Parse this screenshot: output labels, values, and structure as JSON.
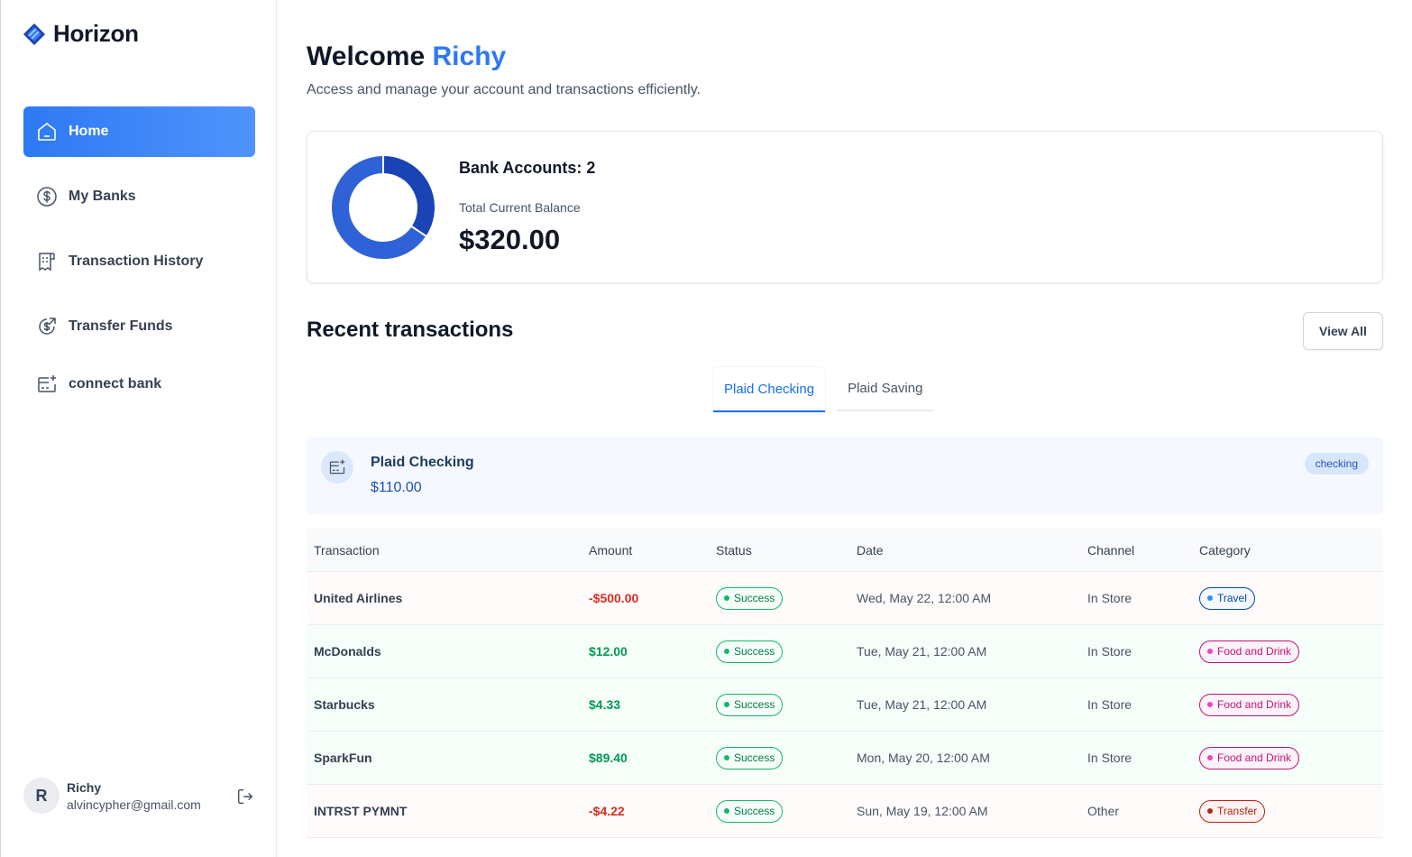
{
  "brand": {
    "name": "Horizon",
    "logo_icon": "horizon-logo-icon",
    "accent": "#2e79f4"
  },
  "sidebar": {
    "items": [
      {
        "label": "Home",
        "icon": "home-icon",
        "active": true
      },
      {
        "label": "My Banks",
        "icon": "dollar-circle-icon",
        "active": false
      },
      {
        "label": "Transaction History",
        "icon": "receipt-icon",
        "active": false
      },
      {
        "label": "Transfer Funds",
        "icon": "money-send-icon",
        "active": false
      },
      {
        "label": "connect bank",
        "icon": "card-add-icon",
        "active": false
      }
    ],
    "user": {
      "initial": "R",
      "name": "Richy",
      "email": "alvincypher@gmail.com",
      "logout_icon": "logout-icon"
    }
  },
  "header": {
    "welcome": "Welcome",
    "user_name": "Richy",
    "subtitle": "Access and manage your account and transactions efficiently."
  },
  "balance": {
    "bank_accounts_label": "Bank Accounts: 2",
    "total_label": "Total Current Balance",
    "total_value": "$320.00",
    "donut": [
      {
        "value": 110,
        "color": "#1a44b5"
      },
      {
        "value": 210,
        "color": "#2f62d6"
      }
    ]
  },
  "recent": {
    "title": "Recent transactions",
    "view_all": "View All",
    "tabs": [
      {
        "label": "Plaid Checking",
        "active": true
      },
      {
        "label": "Plaid Saving",
        "active": false
      }
    ],
    "account": {
      "name": "Plaid Checking",
      "balance": "$110.00",
      "type": "checking",
      "icon": "card-add-icon"
    }
  },
  "transactions": {
    "columns": [
      "Transaction",
      "Amount",
      "Status",
      "Date",
      "Channel",
      "Category"
    ],
    "rows": [
      {
        "name": "United Airlines",
        "amount": "-$500.00",
        "type": "debit",
        "status": "Success",
        "date": "Wed, May 22, 12:00 AM",
        "channel": "In Store",
        "category": "Travel",
        "cat_style": "travel"
      },
      {
        "name": "McDonalds",
        "amount": "$12.00",
        "type": "credit",
        "status": "Success",
        "date": "Tue, May 21, 12:00 AM",
        "channel": "In Store",
        "category": "Food and Drink",
        "cat_style": "food"
      },
      {
        "name": "Starbucks",
        "amount": "$4.33",
        "type": "credit",
        "status": "Success",
        "date": "Tue, May 21, 12:00 AM",
        "channel": "In Store",
        "category": "Food and Drink",
        "cat_style": "food"
      },
      {
        "name": "SparkFun",
        "amount": "$89.40",
        "type": "credit",
        "status": "Success",
        "date": "Mon, May 20, 12:00 AM",
        "channel": "In Store",
        "category": "Food and Drink",
        "cat_style": "food"
      },
      {
        "name": "INTRST PYMNT",
        "amount": "-$4.22",
        "type": "debit",
        "status": "Success",
        "date": "Sun, May 19, 12:00 AM",
        "channel": "Other",
        "category": "Transfer",
        "cat_style": "transfer"
      }
    ]
  }
}
